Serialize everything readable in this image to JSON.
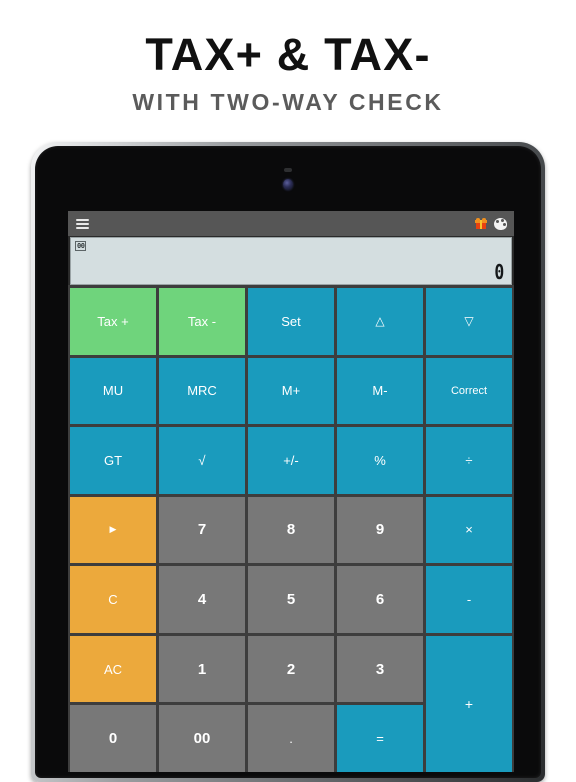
{
  "promo": {
    "headline": "TAX+ & TAX-",
    "subheadline": "WITH TWO-WAY CHECK"
  },
  "device": {
    "sensor": "proximity-sensor",
    "camera": "front-camera"
  },
  "app": {
    "appbar": {
      "menu_icon": "hamburger-menu-icon",
      "gift_icon": "gift-icon",
      "palette_icon": "palette-theme-icon"
    },
    "display": {
      "flag": "00",
      "value": "0"
    },
    "colors": {
      "green": "#6fd47c",
      "blue": "#1a9bbd",
      "orange": "#eca93c",
      "gray": "#787878",
      "appbar": "#565656",
      "display_bg": "#d4dee0"
    },
    "keypad": {
      "rows": [
        [
          {
            "label": "Tax +",
            "color": "green"
          },
          {
            "label": "Tax -",
            "color": "green"
          },
          {
            "label": "Set",
            "color": "blue"
          },
          {
            "label": "△",
            "color": "blue"
          },
          {
            "label": "▽",
            "color": "blue"
          }
        ],
        [
          {
            "label": "MU",
            "color": "blue"
          },
          {
            "label": "MRC",
            "color": "blue"
          },
          {
            "label": "M+",
            "color": "blue"
          },
          {
            "label": "M-",
            "color": "blue"
          },
          {
            "label": "Correct",
            "color": "blue"
          }
        ],
        [
          {
            "label": "GT",
            "color": "blue"
          },
          {
            "label": "√",
            "color": "blue"
          },
          {
            "label": "+/-",
            "color": "blue"
          },
          {
            "label": "%",
            "color": "blue"
          },
          {
            "label": "÷",
            "color": "blue"
          }
        ],
        [
          {
            "label": "▶",
            "color": "orange"
          },
          {
            "label": "7",
            "color": "gray"
          },
          {
            "label": "8",
            "color": "gray"
          },
          {
            "label": "9",
            "color": "gray"
          },
          {
            "label": "×",
            "color": "blue"
          }
        ],
        [
          {
            "label": "C",
            "color": "orange"
          },
          {
            "label": "4",
            "color": "gray"
          },
          {
            "label": "5",
            "color": "gray"
          },
          {
            "label": "6",
            "color": "gray"
          },
          {
            "label": "-",
            "color": "blue"
          }
        ],
        [
          {
            "label": "AC",
            "color": "orange"
          },
          {
            "label": "1",
            "color": "gray"
          },
          {
            "label": "2",
            "color": "gray"
          },
          {
            "label": "3",
            "color": "gray"
          },
          {
            "label": "+",
            "color": "blue"
          }
        ],
        [
          {
            "label": "0",
            "color": "gray"
          },
          {
            "label": "00",
            "color": "gray"
          },
          {
            "label": ".",
            "color": "gray"
          },
          {
            "label": "=",
            "color": "blue"
          }
        ]
      ]
    }
  }
}
